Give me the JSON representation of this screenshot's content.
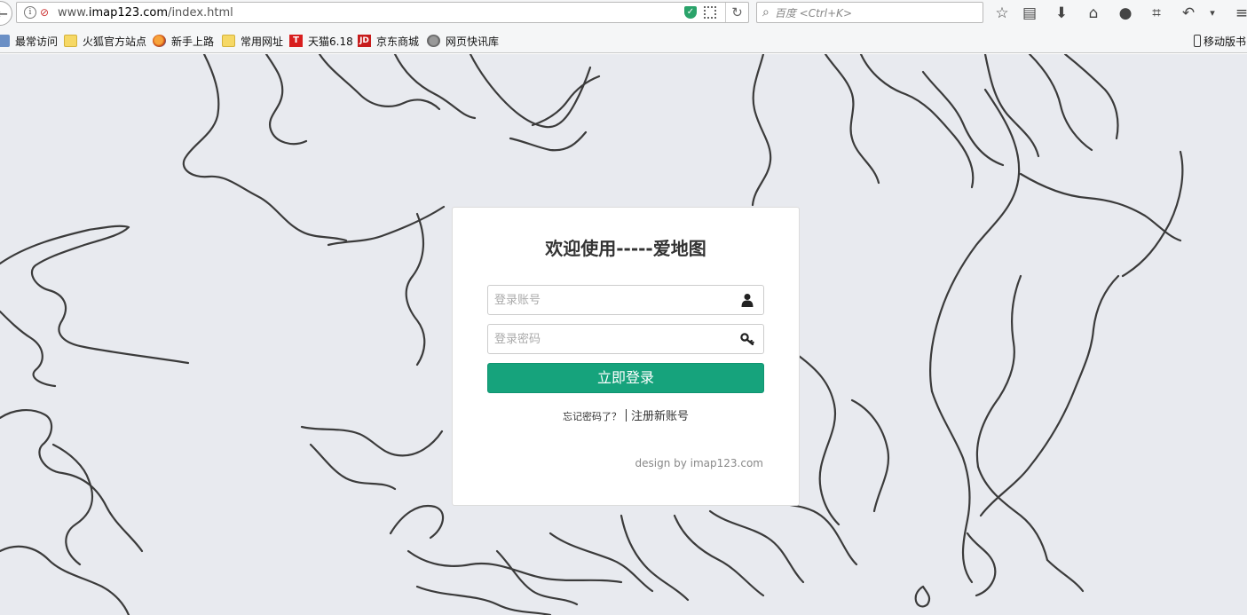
{
  "browser": {
    "url_prefix": "www.",
    "url_domain": "imap123.com",
    "url_path": "/index.html",
    "search_placeholder": "百度 <Ctrl+K>",
    "bookmarks": [
      {
        "label": "最常访问",
        "icon": "recent-icon"
      },
      {
        "label": "火狐官方站点",
        "icon": "folder-icon"
      },
      {
        "label": "新手上路",
        "icon": "firefox-icon"
      },
      {
        "label": "常用网址",
        "icon": "folder-icon"
      },
      {
        "label": "天猫6.18",
        "icon": "tmall-icon"
      },
      {
        "label": "京东商城",
        "icon": "jd-icon"
      },
      {
        "label": "网页快讯库",
        "icon": "globe-icon"
      }
    ],
    "mobile_bookmarks": "移动版书"
  },
  "login": {
    "title": "欢迎使用-----爱地图",
    "username_placeholder": "登录账号",
    "password_placeholder": "登录密码",
    "submit_label": "立即登录",
    "forgot_label": "忘记密码了？",
    "register_label": "注册新账号",
    "credit": "design by imap123.com",
    "accent_color": "#16a37c"
  }
}
